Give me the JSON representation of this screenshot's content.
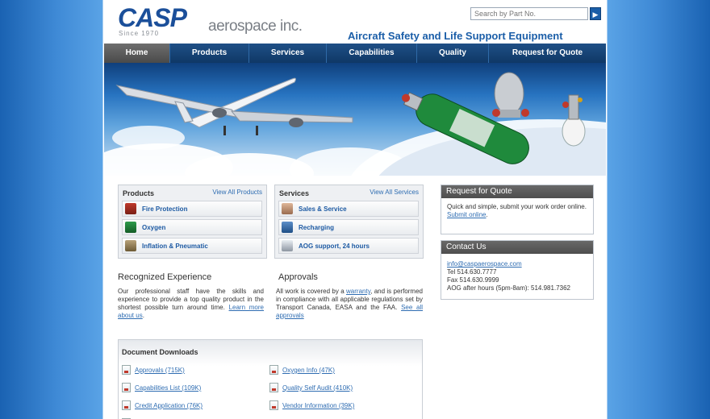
{
  "header": {
    "brand": "CASP",
    "brand_suffix": "aerospace inc.",
    "since": "Since 1970",
    "tagline": "Aircraft Safety and Life Support Equipment",
    "search_placeholder": "Search by Part No."
  },
  "nav": [
    {
      "label": "Home"
    },
    {
      "label": "Products"
    },
    {
      "label": "Services"
    },
    {
      "label": "Capabilities"
    },
    {
      "label": "Quality"
    },
    {
      "label": "Request for Quote"
    }
  ],
  "products": {
    "title": "Products",
    "view_all": "View All Products",
    "items": [
      {
        "label": "Fire Protection",
        "icon": "fire-extinguisher-icon"
      },
      {
        "label": "Oxygen",
        "icon": "oxygen-bottle-icon"
      },
      {
        "label": "Inflation & Pneumatic",
        "icon": "valve-icon"
      }
    ]
  },
  "services": {
    "title": "Services",
    "view_all": "View All Services",
    "items": [
      {
        "label": "Sales & Service",
        "icon": "person-icon"
      },
      {
        "label": "Recharging",
        "icon": "recharge-icon"
      },
      {
        "label": "AOG support, 24 hours",
        "icon": "airplane-icon"
      }
    ]
  },
  "experience": {
    "title": "Recognized Experience",
    "body": "Our professional staff have the skills and experience to provide a top quality product in the shortest possible turn around time. ",
    "link": "Learn more about us",
    "after": "."
  },
  "approvals": {
    "title": "Approvals",
    "body_pre": "All work is covered by a ",
    "warranty_link": "warranty",
    "body_post": ", and is performed in compliance with all applicable regulations set by Transport Canada, EASA and the FAA. ",
    "see_all_link": "See all approvals"
  },
  "rfq": {
    "title": "Request for Quote",
    "body": "Quick and simple, submit your work order online. ",
    "link": "Submit online",
    "after": "."
  },
  "contact": {
    "title": "Contact Us",
    "email": "info@caspaerospace.com",
    "tel": "Tel 514.630.7777",
    "fax": "Fax 514.630.9999",
    "aog": "AOG after hours (5pm-8am): 514.981.7362"
  },
  "downloads": {
    "title": "Document Downloads",
    "left": [
      "Approvals (715K)",
      "Capabilities List (109K)",
      "Credit Application (76K)"
    ],
    "right": [
      "Oxygen Info (47K)",
      "Quality Self Audit (410K)",
      "Vendor Information (39K)"
    ]
  },
  "colors": {
    "brand_blue": "#1b5ea8",
    "nav_dark": "#0f3866",
    "link": "#2f6db2"
  }
}
